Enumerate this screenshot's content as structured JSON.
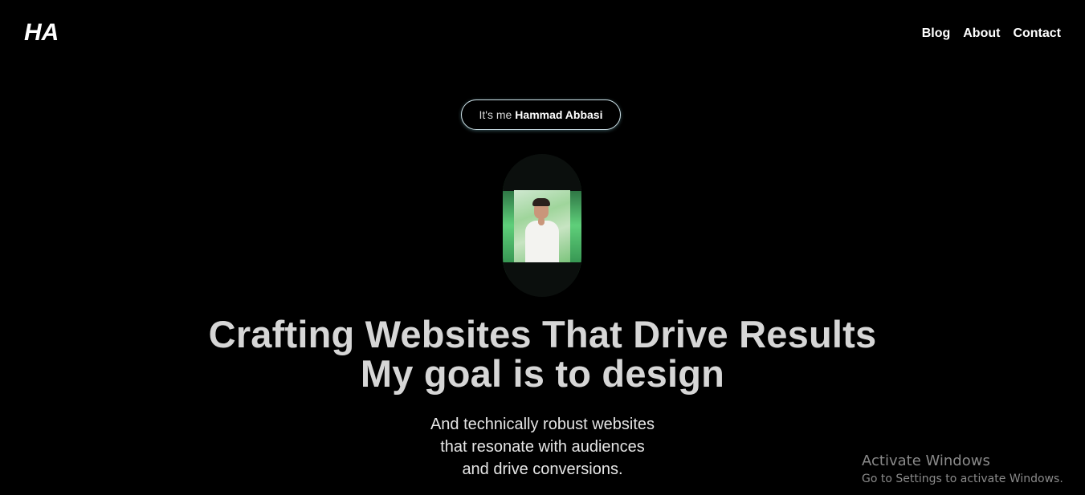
{
  "header": {
    "logo": "HA",
    "nav": [
      {
        "label": "Blog"
      },
      {
        "label": "About"
      },
      {
        "label": "Contact"
      }
    ]
  },
  "hero": {
    "badge_prefix": "It's me",
    "badge_name": "Hammad Abbasi",
    "headline_line1": "Crafting Websites That Drive Results",
    "headline_line2": "My goal is to design",
    "sub_line1": "And technically robust websites",
    "sub_line2": "that resonate with audiences",
    "sub_line3": "and drive conversions."
  },
  "watermark": {
    "title": "Activate Windows",
    "subtitle": "Go to Settings to activate Windows."
  },
  "colors": {
    "background": "#000000",
    "accent_green": "#5fcf7a",
    "headline": "#d6d6d6",
    "badge_border": "#cfe3ea"
  }
}
